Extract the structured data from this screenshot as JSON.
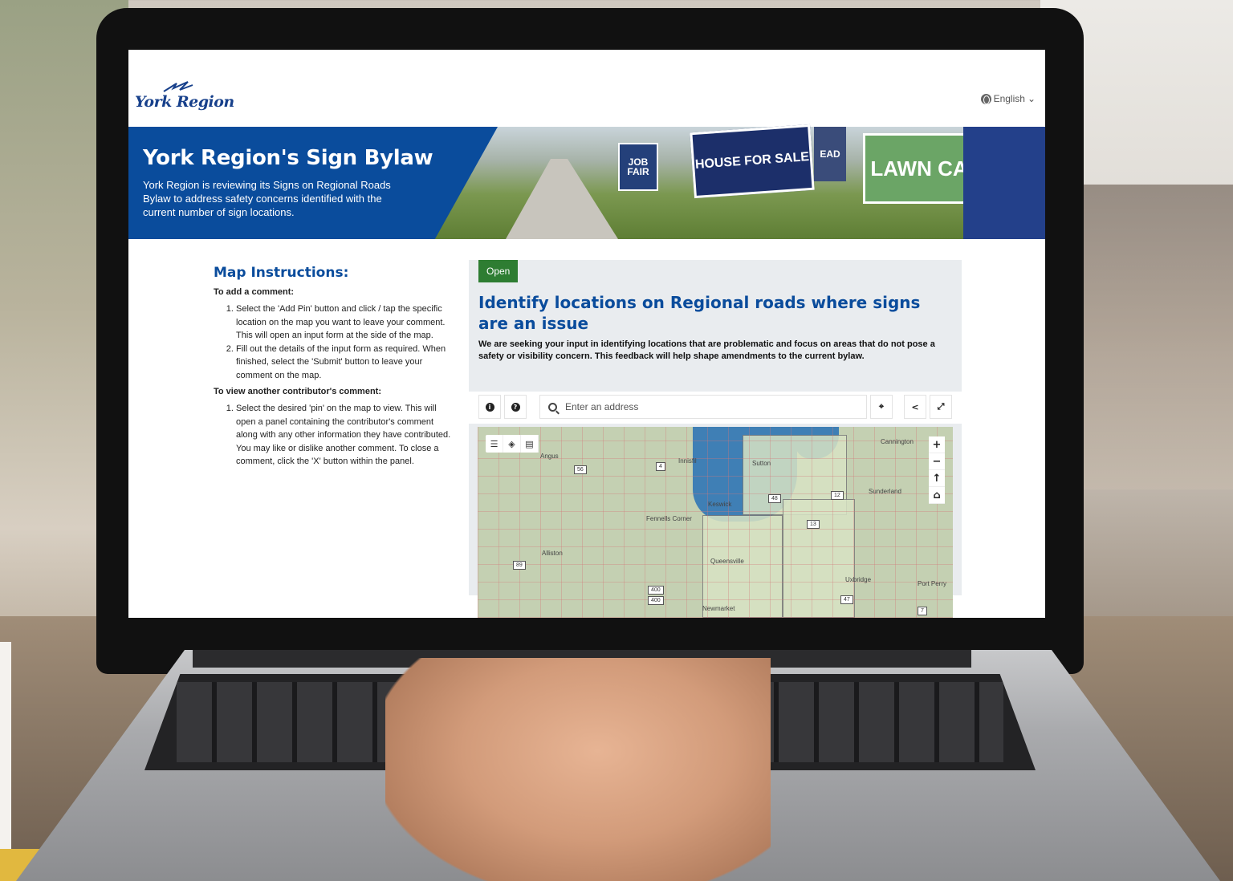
{
  "header": {
    "logo_text": "York Region",
    "language": "English"
  },
  "hero": {
    "title": "York Region's Sign Bylaw",
    "description": "York Region is reviewing its Signs on Regional Roads Bylaw to address safety concerns identified with the current number of sign locations.",
    "photo_signs": {
      "job_fair": "JOB FAIR",
      "house": "HOUSE FOR SALE",
      "lawn": "LAWN CA",
      "ead": "EAD"
    }
  },
  "instructions": {
    "title": "Map Instructions:",
    "add_heading": "To add a comment:",
    "add_steps": [
      "Select the 'Add Pin' button and click / tap the specific location on the map you want to leave your comment. This will open an input form at the side of the map.",
      "Fill out the details of the input form as required. When finished, select the 'Submit' button to leave your comment on the map."
    ],
    "view_heading": "To view another contributor's comment:",
    "view_steps": [
      "Select the desired 'pin' on the map to view. This will open a panel containing the contributor's comment along with any other information they have contributed. You may like or dislike another comment. To close a comment, click the 'X' button within the panel."
    ]
  },
  "panel": {
    "status": "Open",
    "title": "Identify locations on Regional roads where signs are an issue",
    "description": "We are seeking your input in identifying locations that are problematic and focus on areas that do not pose a safety or visibility concern. This feedback will help shape amendments to the current bylaw."
  },
  "map_toolbar": {
    "search_placeholder": "Enter an address"
  },
  "map": {
    "labels": {
      "angus": "Angus",
      "innisfil": "Innisfil",
      "sutton": "Sutton",
      "cannington": "Cannington",
      "sunderland": "Sunderland",
      "keswick": "Keswick",
      "fennells": "Fennells Corner",
      "alliston": "Alliston",
      "queensville": "Queensville",
      "uxbridge": "Uxbridge",
      "port_perry": "Port Perry",
      "newmarket": "Newmarket"
    },
    "shields": {
      "r56": "56",
      "r4": "4",
      "r48": "48",
      "r12": "12",
      "r13": "13",
      "r89": "89",
      "r400a": "400",
      "r400b": "400",
      "r47": "47",
      "r7": "7"
    }
  },
  "colors": {
    "brand_blue": "#0a4c9c",
    "open_green": "#2e7d32"
  }
}
